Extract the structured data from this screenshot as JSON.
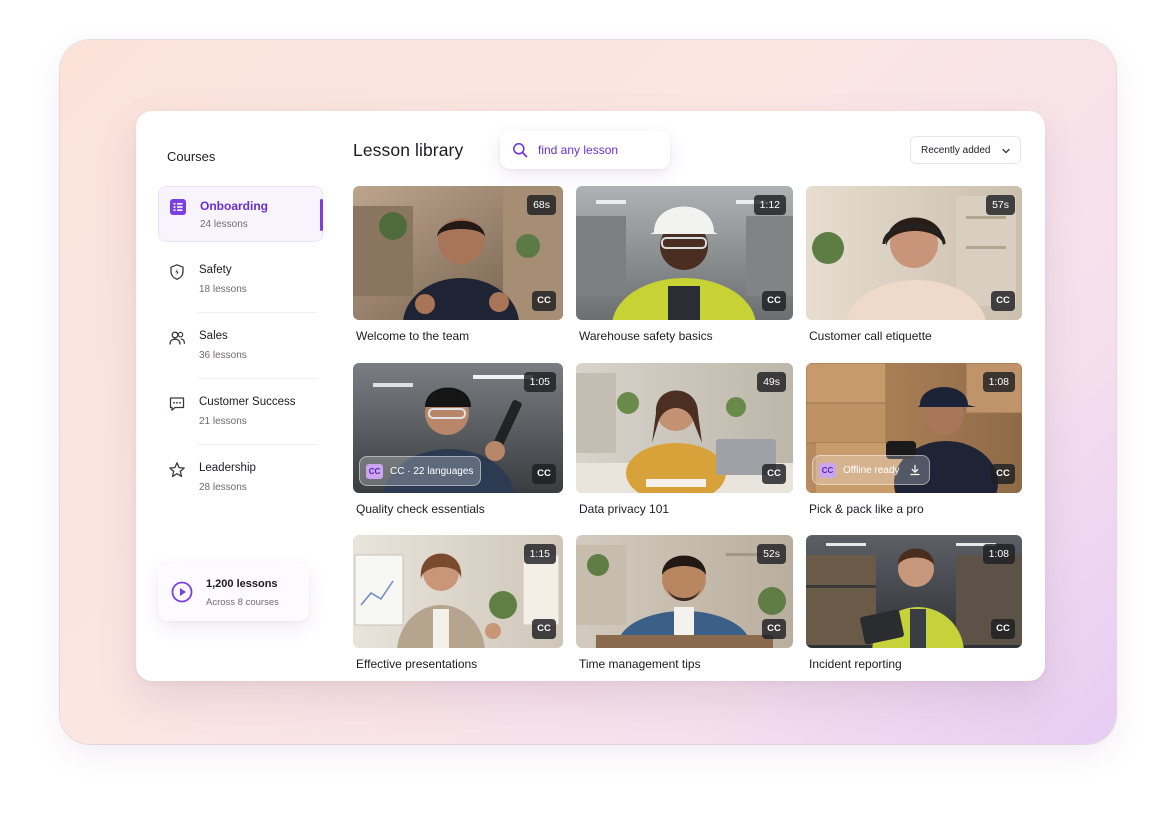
{
  "sidebar": {
    "title": "Courses",
    "items": [
      {
        "label": "Onboarding",
        "count": "24 lessons",
        "icon": "list-icon",
        "active": true
      },
      {
        "label": "Safety",
        "count": "18 lessons",
        "icon": "shield-icon",
        "active": false
      },
      {
        "label": "Sales",
        "count": "36 lessons",
        "icon": "users-icon",
        "active": false
      },
      {
        "label": "Customer Success",
        "count": "21 lessons",
        "icon": "chat-icon",
        "active": false
      },
      {
        "label": "Leadership",
        "count": "28 lessons",
        "icon": "star-icon",
        "active": false
      }
    ],
    "summary": {
      "title": "1,200 lessons",
      "subtitle": "Across 8 courses",
      "icon": "play-circle-icon"
    }
  },
  "header": {
    "title": "Lesson library",
    "search_placeholder": "find any lesson",
    "sort_label": "Recently added"
  },
  "lessons": [
    {
      "title": "Welcome to the team",
      "duration": "68s",
      "cc": "CC"
    },
    {
      "title": "Warehouse safety basics",
      "duration": "1:12",
      "cc": "CC"
    },
    {
      "title": "Customer call etiquette",
      "duration": "57s",
      "cc": "CC"
    },
    {
      "title": "Quality check essentials",
      "duration": "1:05",
      "cc": "CC",
      "chip": {
        "badge": "CC",
        "text": "CC · 22 languages"
      }
    },
    {
      "title": "Data privacy 101",
      "duration": "49s",
      "cc": "CC"
    },
    {
      "title": "Pick & pack like a pro",
      "duration": "1:08",
      "cc": "CC",
      "chip": {
        "badge": "CC",
        "text": "Offline ready",
        "icon": "download-icon"
      }
    },
    {
      "title": "Effective presentations",
      "duration": "1:15",
      "cc": "CC"
    },
    {
      "title": "Time management tips",
      "duration": "52s",
      "cc": "CC"
    },
    {
      "title": "Incident reporting",
      "duration": "1:08",
      "cc": "CC"
    }
  ],
  "colors": {
    "accent": "#6a2fd6",
    "active_bg": "#f8f4fd",
    "badge_bg": "#1e1e22"
  }
}
